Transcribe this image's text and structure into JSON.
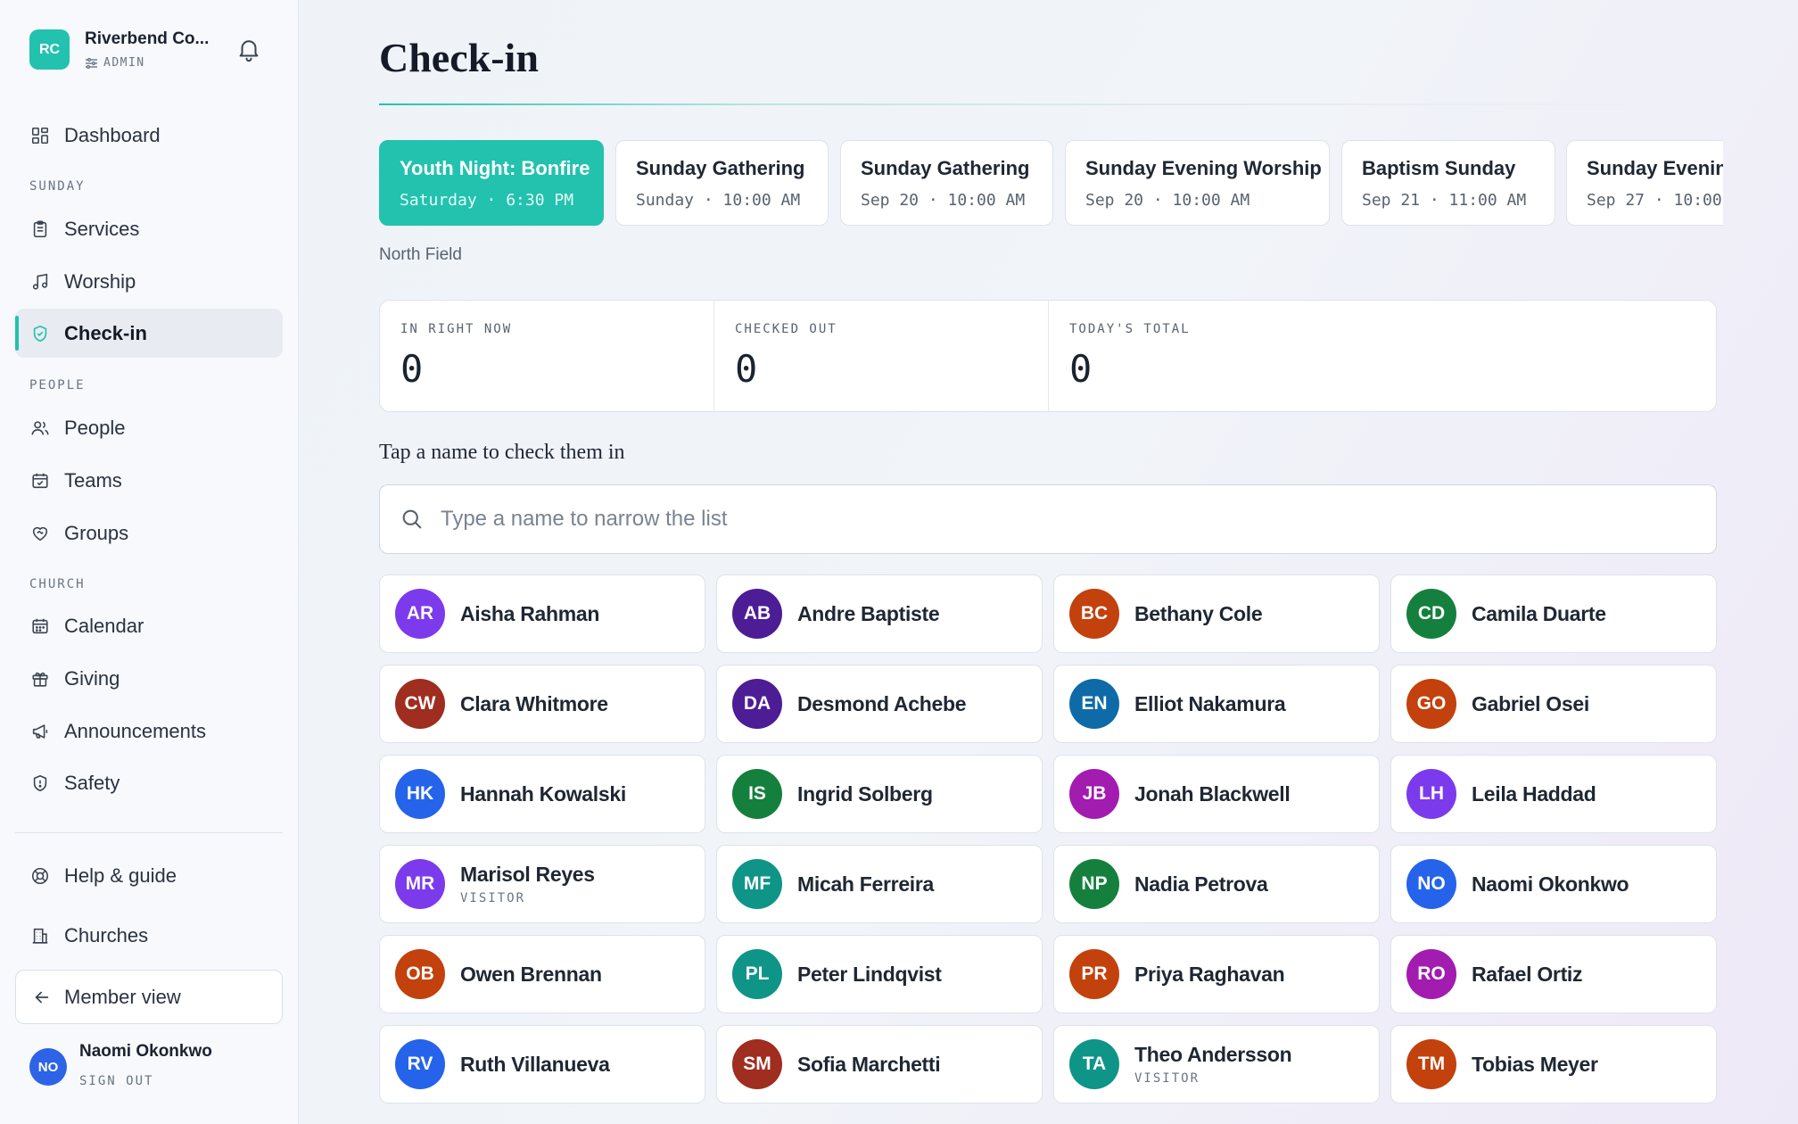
{
  "org": {
    "initials": "RC",
    "name": "Riverbend Co...",
    "role": "ADMIN"
  },
  "nav": {
    "dashboard": "Dashboard",
    "section_sunday": "SUNDAY",
    "services": "Services",
    "worship": "Worship",
    "checkin": "Check-in",
    "section_people": "PEOPLE",
    "people": "People",
    "teams": "Teams",
    "groups": "Groups",
    "section_church": "CHURCH",
    "calendar": "Calendar",
    "giving": "Giving",
    "announcements": "Announcements",
    "safety": "Safety",
    "help": "Help & guide",
    "churches": "Churches",
    "member_view": "Member view"
  },
  "user": {
    "initials": "NO",
    "name": "Naomi Okonkwo",
    "sign_out": "SIGN OUT"
  },
  "page": {
    "title": "Check-in",
    "location": "North Field",
    "hint": "Tap a name to check them in"
  },
  "events": [
    {
      "name": "Youth Night: Bonfire",
      "when": "Saturday · 6:30 PM",
      "selected": true
    },
    {
      "name": "Sunday Gathering",
      "when": "Sunday · 10:00 AM",
      "selected": false
    },
    {
      "name": "Sunday Gathering",
      "when": "Sep 20 · 10:00 AM",
      "selected": false
    },
    {
      "name": "Sunday Evening Worship",
      "when": "Sep 20 · 10:00 AM",
      "selected": false
    },
    {
      "name": "Baptism Sunday",
      "when": "Sep 21 · 11:00 AM",
      "selected": false
    },
    {
      "name": "Sunday Evening",
      "when": "Sep 27 · 10:00",
      "selected": false
    }
  ],
  "stats": [
    {
      "label": "IN RIGHT NOW",
      "value": "0"
    },
    {
      "label": "CHECKED OUT",
      "value": "0"
    },
    {
      "label": "TODAY'S TOTAL",
      "value": "0"
    }
  ],
  "search": {
    "placeholder": "Type a name to narrow the list",
    "value": ""
  },
  "people": [
    {
      "initials": "AR",
      "name": "Aisha Rahman",
      "color": "#7c3aed",
      "tag": ""
    },
    {
      "initials": "AB",
      "name": "Andre Baptiste",
      "color": "#4c1d95",
      "tag": ""
    },
    {
      "initials": "BC",
      "name": "Bethany Cole",
      "color": "#c2410c",
      "tag": ""
    },
    {
      "initials": "CD",
      "name": "Camila Duarte",
      "color": "#15803d",
      "tag": ""
    },
    {
      "initials": "CW",
      "name": "Clara Whitmore",
      "color": "#9f2d20",
      "tag": ""
    },
    {
      "initials": "DA",
      "name": "Desmond Achebe",
      "color": "#4c1d95",
      "tag": ""
    },
    {
      "initials": "EN",
      "name": "Elliot Nakamura",
      "color": "#0e6ba8",
      "tag": ""
    },
    {
      "initials": "GO",
      "name": "Gabriel Osei",
      "color": "#c2410c",
      "tag": ""
    },
    {
      "initials": "HK",
      "name": "Hannah Kowalski",
      "color": "#2563eb",
      "tag": ""
    },
    {
      "initials": "IS",
      "name": "Ingrid Solberg",
      "color": "#15803d",
      "tag": ""
    },
    {
      "initials": "JB",
      "name": "Jonah Blackwell",
      "color": "#a21caf",
      "tag": ""
    },
    {
      "initials": "LH",
      "name": "Leila Haddad",
      "color": "#7c3aed",
      "tag": ""
    },
    {
      "initials": "MR",
      "name": "Marisol Reyes",
      "color": "#7c3aed",
      "tag": "VISITOR"
    },
    {
      "initials": "MF",
      "name": "Micah Ferreira",
      "color": "#0f9488",
      "tag": ""
    },
    {
      "initials": "NP",
      "name": "Nadia Petrova",
      "color": "#15803d",
      "tag": ""
    },
    {
      "initials": "NO",
      "name": "Naomi Okonkwo",
      "color": "#2563eb",
      "tag": ""
    },
    {
      "initials": "OB",
      "name": "Owen Brennan",
      "color": "#c2410c",
      "tag": ""
    },
    {
      "initials": "PL",
      "name": "Peter Lindqvist",
      "color": "#0f9488",
      "tag": ""
    },
    {
      "initials": "PR",
      "name": "Priya Raghavan",
      "color": "#c2410c",
      "tag": ""
    },
    {
      "initials": "RO",
      "name": "Rafael Ortiz",
      "color": "#a21caf",
      "tag": ""
    },
    {
      "initials": "RV",
      "name": "Ruth Villanueva",
      "color": "#2563eb",
      "tag": ""
    },
    {
      "initials": "SM",
      "name": "Sofia Marchetti",
      "color": "#9f2d20",
      "tag": ""
    },
    {
      "initials": "TA",
      "name": "Theo Andersson",
      "color": "#0f9488",
      "tag": "VISITOR"
    },
    {
      "initials": "TM",
      "name": "Tobias Meyer",
      "color": "#c2410c",
      "tag": ""
    }
  ],
  "theme": {
    "accent": "#22c2ae"
  }
}
